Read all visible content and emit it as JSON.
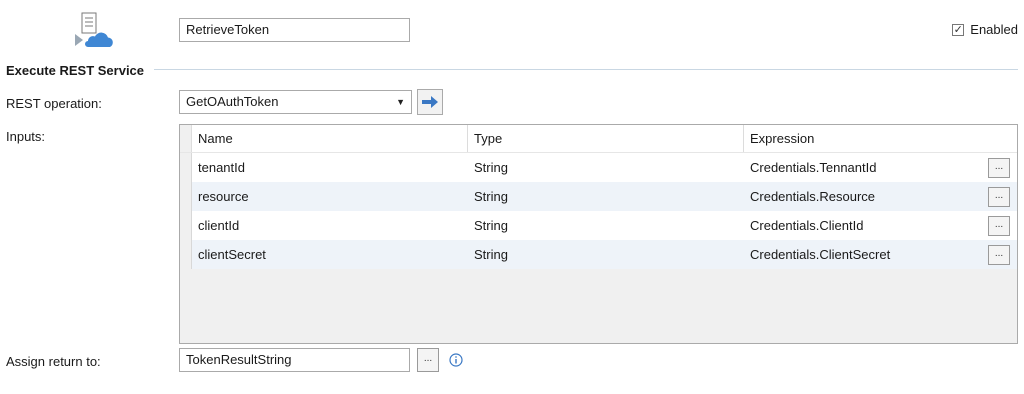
{
  "activity": {
    "name": "RetrieveToken",
    "icon": "rest-service-cloud-icon",
    "enabled_label": "Enabled",
    "enabled": true
  },
  "section": {
    "title": "Execute REST Service"
  },
  "rest_operation": {
    "label": "REST operation:",
    "value": "GetOAuthToken",
    "go_icon": "arrow-right-icon"
  },
  "inputs": {
    "label": "Inputs:",
    "columns": [
      "Name",
      "Type",
      "Expression"
    ],
    "rows": [
      {
        "name": "tenantId",
        "type": "String",
        "expression": "Credentials.TennantId"
      },
      {
        "name": "resource",
        "type": "String",
        "expression": "Credentials.Resource"
      },
      {
        "name": "clientId",
        "type": "String",
        "expression": "Credentials.ClientId"
      },
      {
        "name": "clientSecret",
        "type": "String",
        "expression": "Credentials.ClientSecret"
      }
    ],
    "edit_label": "..."
  },
  "assign": {
    "label": "Assign return to:",
    "value": "TokenResultString",
    "browse_label": "...",
    "info_icon": "info-icon"
  },
  "colors": {
    "accent": "#3a78c4",
    "row_alt": "#eef3f9",
    "border": "#aaaaaa"
  }
}
